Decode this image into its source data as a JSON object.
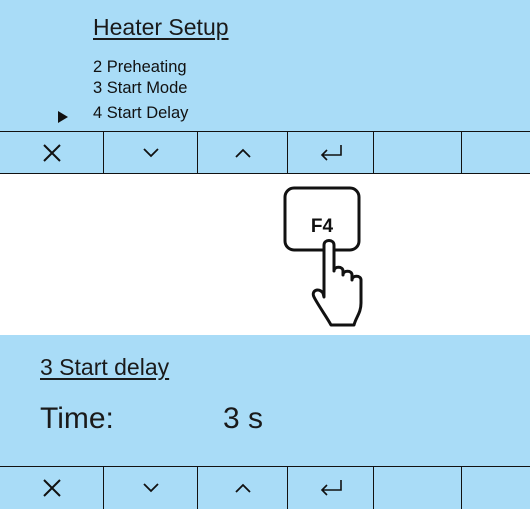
{
  "menu": {
    "title": "Heater Setup",
    "items": [
      {
        "label": "2 Preheating"
      },
      {
        "label": "3 Start Mode"
      },
      {
        "label": "4 Start Delay",
        "selected": true
      }
    ]
  },
  "softkeys": [
    {
      "icon": "close-icon"
    },
    {
      "icon": "chevron-down-icon"
    },
    {
      "icon": "chevron-up-icon"
    },
    {
      "icon": "enter-icon"
    },
    {
      "icon": ""
    },
    {
      "icon": ""
    }
  ],
  "press": {
    "key_label": "F4",
    "icon": "hand-pointer-icon"
  },
  "delay_screen": {
    "title": "3 Start delay",
    "time_label": "Time:",
    "time_value": "3 s"
  },
  "colors": {
    "lcd_background": "#a9dcf7",
    "text": "#1a1a1a",
    "lines": "#111111"
  }
}
